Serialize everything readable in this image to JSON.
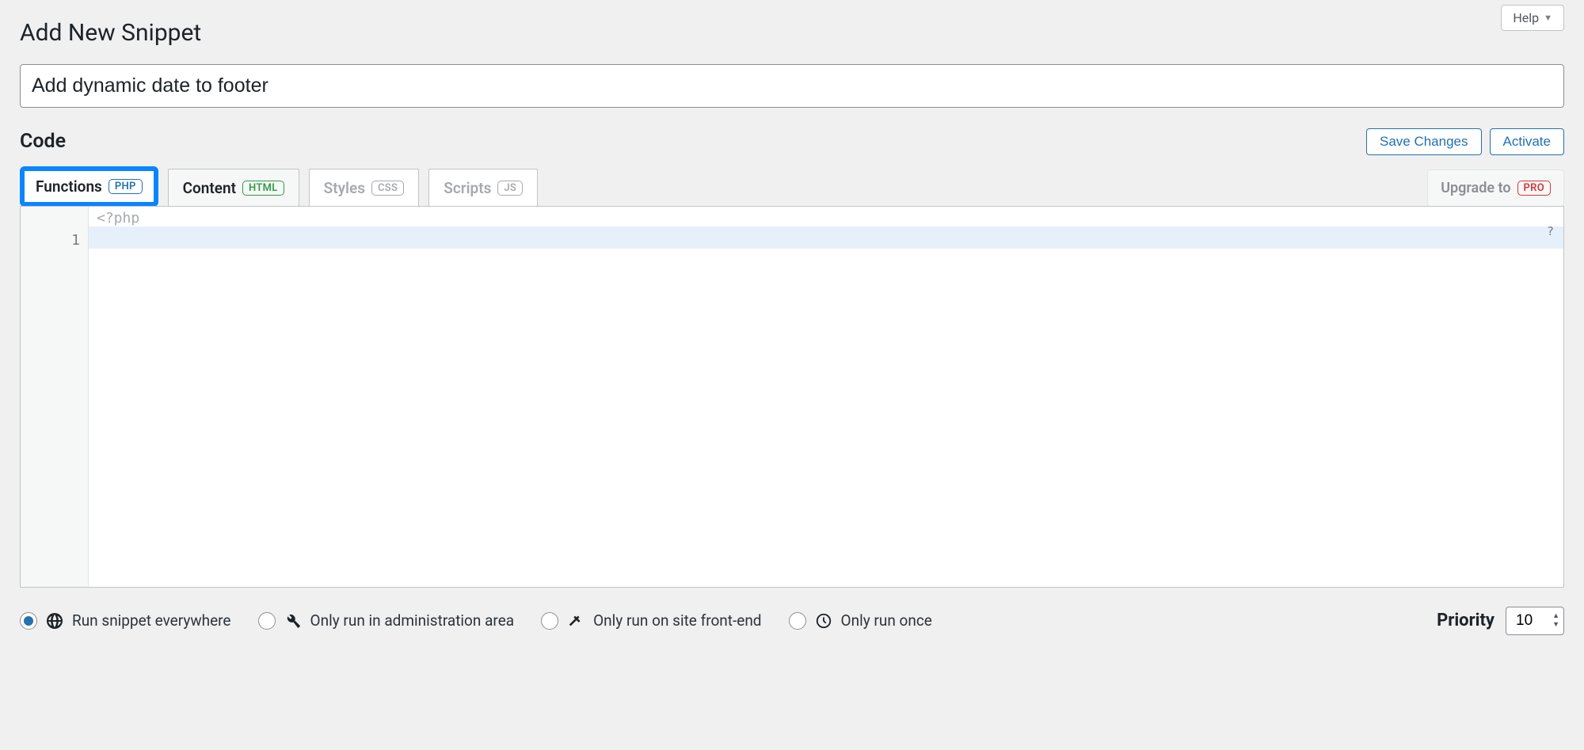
{
  "header": {
    "help_label": "Help",
    "page_title": "Add New Snippet"
  },
  "title_input": {
    "value": "Add dynamic date to footer"
  },
  "code_section": {
    "heading": "Code",
    "save_label": "Save Changes",
    "activate_label": "Activate"
  },
  "tabs": {
    "functions": {
      "label": "Functions",
      "badge": "PHP"
    },
    "content": {
      "label": "Content",
      "badge": "HTML"
    },
    "styles": {
      "label": "Styles",
      "badge": "CSS"
    },
    "scripts": {
      "label": "Scripts",
      "badge": "JS"
    },
    "upgrade": {
      "label": "Upgrade to",
      "badge": "PRO"
    }
  },
  "editor": {
    "php_open": "<?php",
    "line_number": "1",
    "help_symbol": "?"
  },
  "scope": {
    "everywhere": "Run snippet everywhere",
    "admin": "Only run in administration area",
    "frontend": "Only run on site front-end",
    "once": "Only run once"
  },
  "priority": {
    "label": "Priority",
    "value": "10"
  }
}
